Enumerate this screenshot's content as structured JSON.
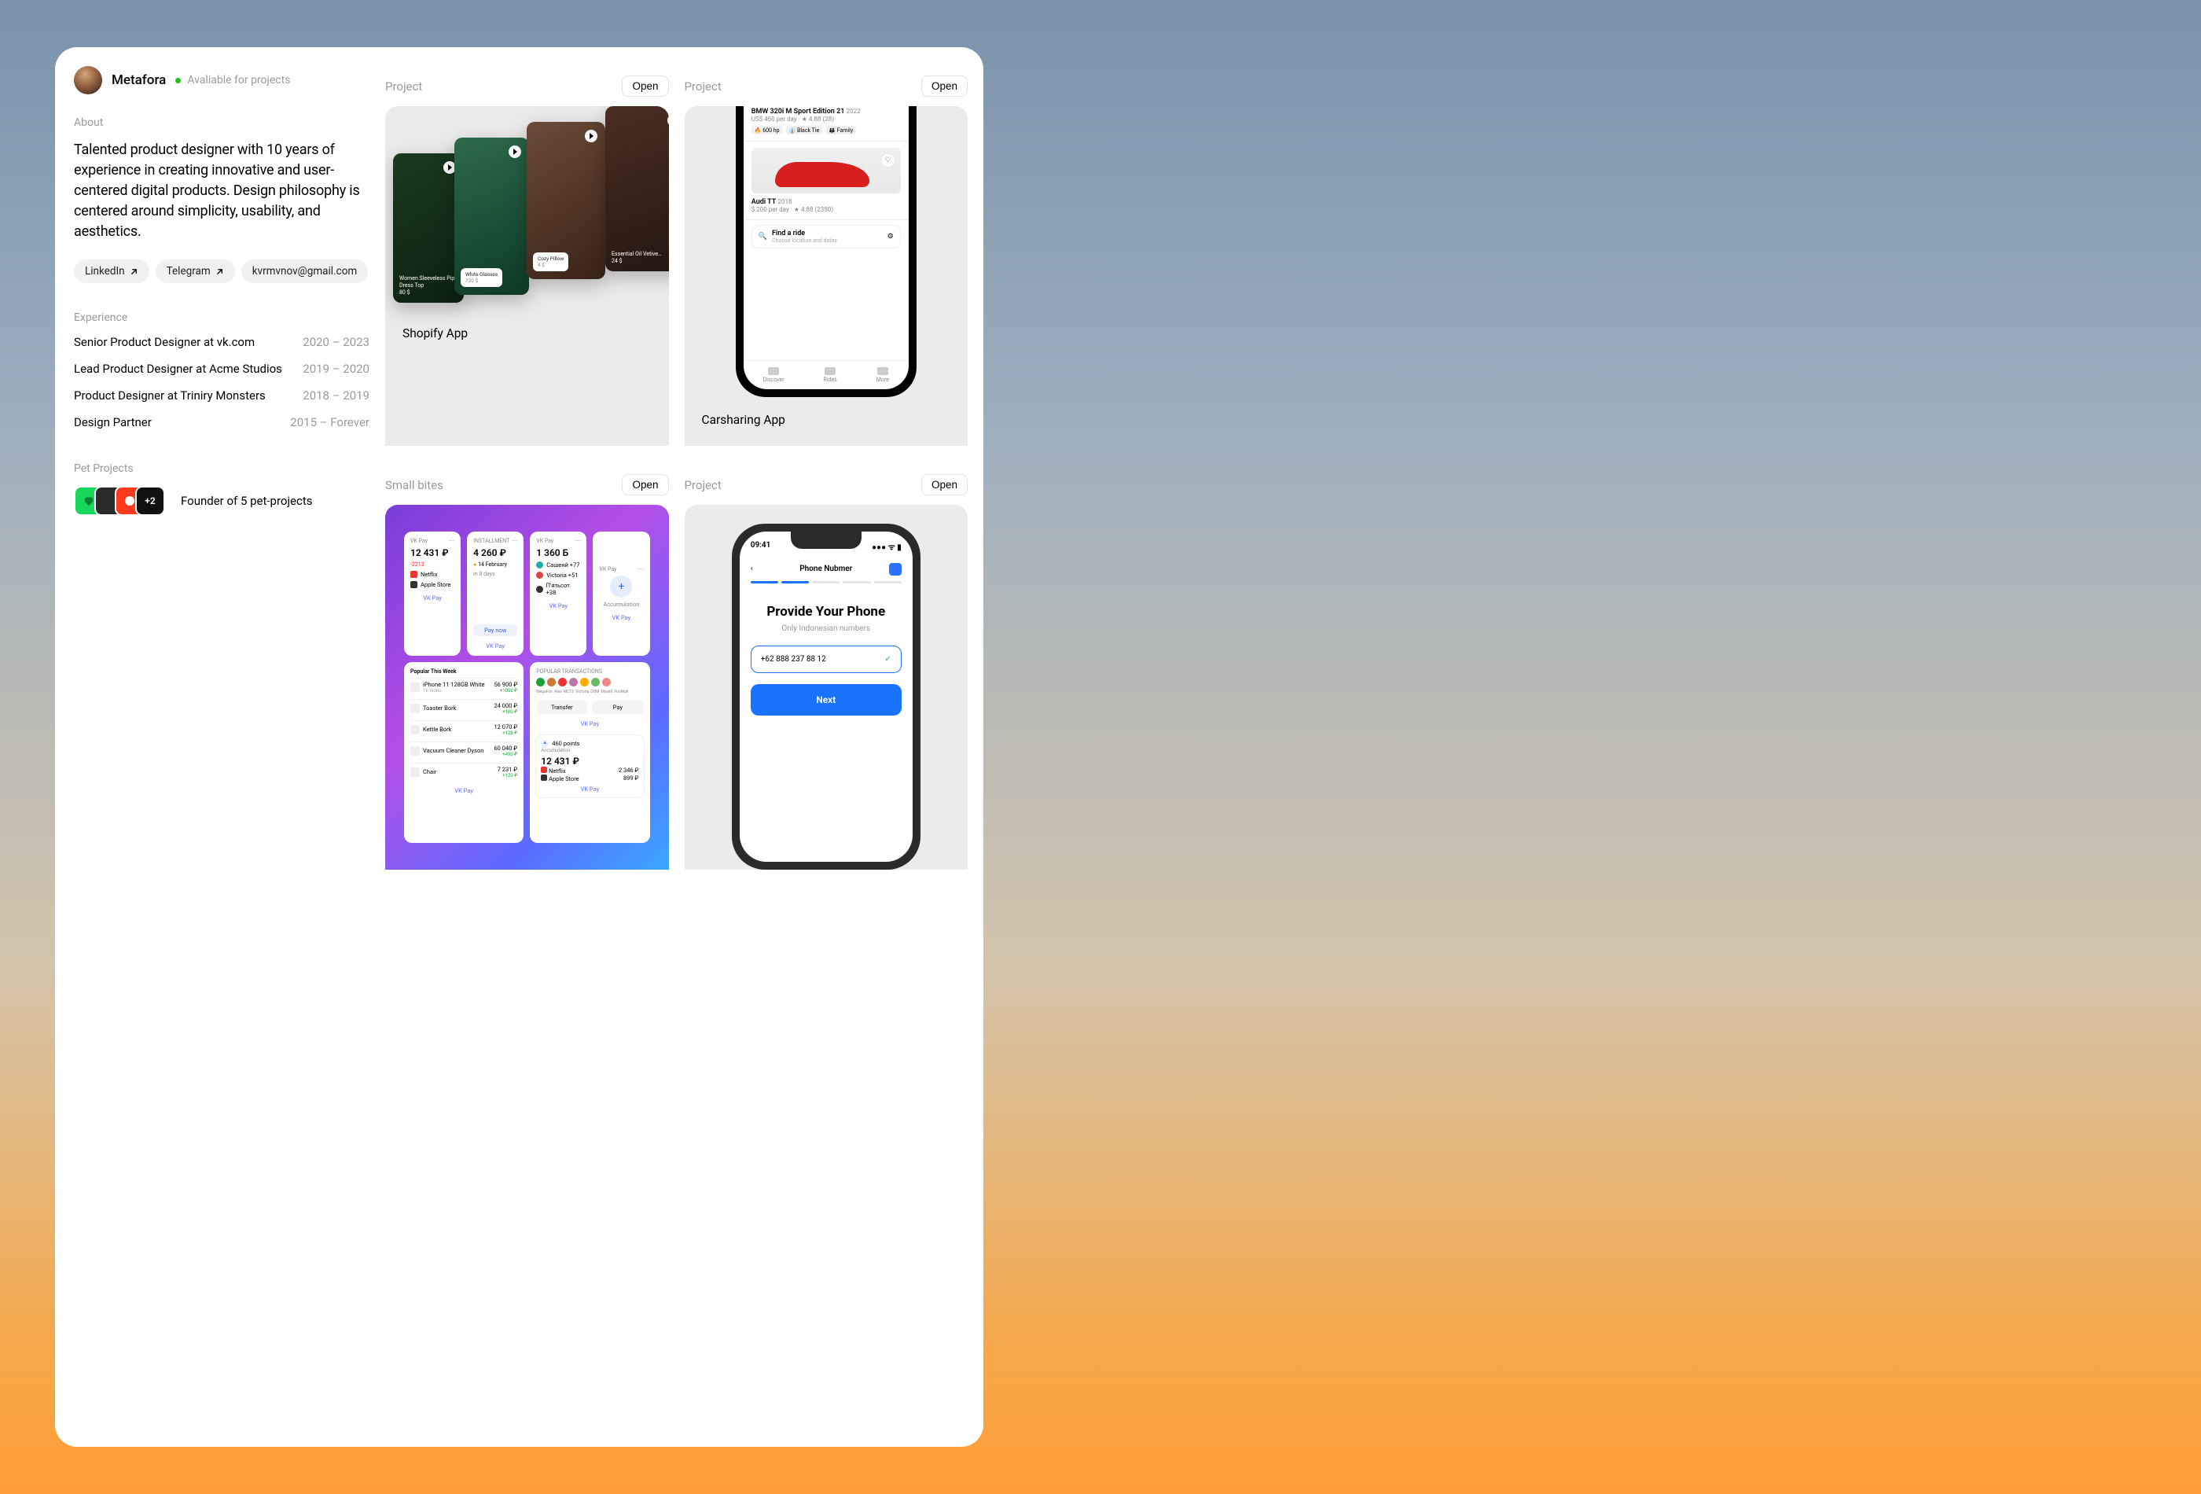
{
  "profile": {
    "name": "Metafora",
    "status": "Avaliable for projects"
  },
  "about": {
    "label": "About",
    "bio": "Talented product designer with 10 years of experience in creating innovative and user-centered digital products. Design philosophy is centered around simplicity, usability, and aesthetics."
  },
  "links": {
    "linkedin": "LinkedIn",
    "telegram": "Telegram",
    "email": "kvrmvnov@gmail.com"
  },
  "experience": {
    "label": "Experience",
    "items": [
      {
        "role": "Senior Product Designer at vk.com",
        "dates": "2020 – 2023"
      },
      {
        "role": "Lead Product Designer at Acme Studios",
        "dates": "2019 – 2020"
      },
      {
        "role": "Product Designer at Triniry Monsters",
        "dates": "2018 – 2019"
      },
      {
        "role": "Design Partner",
        "dates": "2015 – Forever"
      }
    ]
  },
  "pet": {
    "label": "Pet Projects",
    "text": "Founder of 5 pet-projects",
    "more": "+2"
  },
  "buttons": {
    "open": "Open"
  },
  "sections": {
    "project": "Project",
    "small_bites": "Small bites"
  },
  "shopify": {
    "title": "Shopify App",
    "cards": [
      {
        "title": "Women Sleeveless Piper Dress Top",
        "price": "80 $"
      },
      {
        "title": "White Glasses",
        "price": "720 $"
      },
      {
        "title": "Cozy Pillow",
        "price": "4 $"
      },
      {
        "title": "Essential Oil Vetive…",
        "price": "24 $"
      }
    ]
  },
  "carsharing": {
    "title": "Carsharing App",
    "car1": {
      "name": "BMW 320i M Sport Edition 21",
      "year": "2022",
      "price": "US$ 460 per day",
      "rating": "4.88 (28)",
      "b1": "600 hp",
      "b2": "Black Tie",
      "b3": "Family"
    },
    "car2": {
      "name": "Audi TT",
      "year": "2018",
      "price": "$ 200 per day",
      "rating": "4.88 (2350)"
    },
    "search": {
      "title": "Find a ride",
      "sub": "Choose location and dates"
    },
    "tabs": {
      "t1": "Discover",
      "t2": "Rides",
      "t3": "More"
    }
  },
  "widgets": {
    "vkpay": "VK Pay",
    "w1": {
      "amount": "12 431 ₽",
      "delta": "-2213",
      "s1": "Netflix",
      "s2": "Apple Store"
    },
    "w2": {
      "label": "INSTALLMENT",
      "amount": "4 260 ₽",
      "date": "14 February",
      "sub": "in 8 days",
      "cta": "Pay now"
    },
    "w3": {
      "amount": "1 360 Б",
      "n1": "Сашенй +77",
      "n2": "Victoria +51",
      "n3": "П'ятьсот. +38"
    },
    "w4": {
      "label": "Accumulation"
    },
    "popular_label": "Popular This Week",
    "popular": [
      {
        "name": "iPhone 11 128GB White",
        "sub": "16 Video",
        "price": "56 900 ₽",
        "old": "+1000 ₽"
      },
      {
        "name": "Toaster Bork",
        "price": "24 000 ₽",
        "old": "+100 ₽"
      },
      {
        "name": "Kettle Bork",
        "price": "12 070 ₽",
        "old": "+128 ₽"
      },
      {
        "name": "Vacuum Cleaner Dyson",
        "price": "60 040 ₽",
        "old": "+490 ₽"
      },
      {
        "name": "Chair",
        "price": "7 231 ₽",
        "old": "+120 ₽"
      }
    ],
    "trans_label": "POPULAR TRANSACTIONS",
    "people": [
      "MegaFon",
      "Alex",
      "MCTS",
      "Victoria",
      "DHM",
      "Myself",
      "FonMall"
    ],
    "act1": "Transfer",
    "act2": "Pay",
    "w5": {
      "pts": "460 points",
      "sub": "Accumulation",
      "amount": "12 431 ₽",
      "s1": "Netflix",
      "s2": "Apple Store",
      "d1": "2 346 ₽",
      "d2": "899 ₽"
    }
  },
  "phoneproj": {
    "time": "09:41",
    "nav_title": "Phone Nubmer",
    "h1": "Provide Your Phone",
    "sub": "Only Indonesian numbers",
    "value": "+62 888 237 88 12",
    "next": "Next"
  }
}
